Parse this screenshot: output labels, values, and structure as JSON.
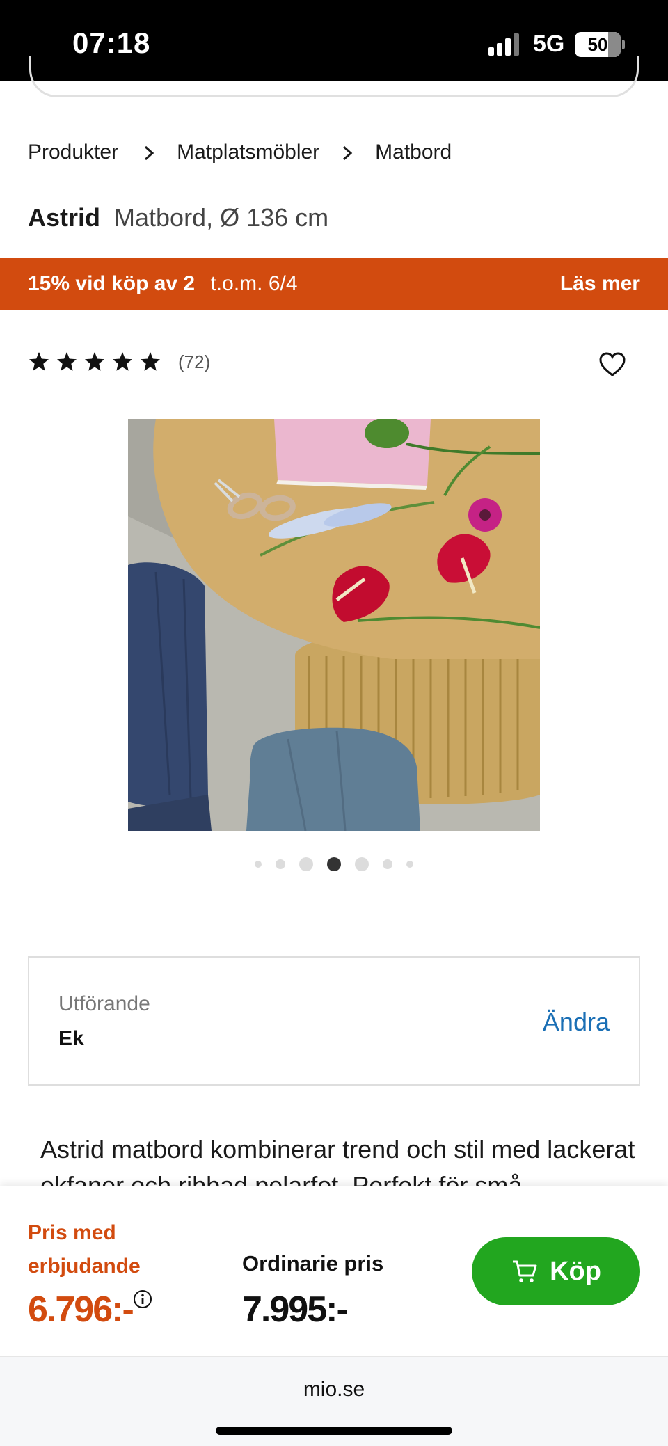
{
  "status_bar": {
    "time": "07:18",
    "network": "5G",
    "battery": "50"
  },
  "breadcrumb": [
    "Produkter",
    "Matplatsmöbler",
    "Matbord"
  ],
  "product": {
    "name": "Astrid",
    "description": "Matbord, Ø 136 cm"
  },
  "promo": {
    "offer": "15% vid köp av 2",
    "until": "t.o.m. 6/4",
    "link": "Läs mer",
    "color": "#d24b0f"
  },
  "rating": {
    "stars": 5,
    "count": "(72)"
  },
  "gallery": {
    "image_count": 7,
    "active_index": 3
  },
  "variant": {
    "label": "Utförande",
    "value": "Ek",
    "change_label": "Ändra"
  },
  "description_text": "Astrid matbord kombinerar trend och stil med lackerat ekfaner och ribbad pelarfot. Perfekt för små",
  "price": {
    "offer_label": "Pris med erbjudande",
    "offer_price": "6.796:-",
    "ordinary_label": "Ordinarie pris",
    "ordinary_price": "7.995:-",
    "buy_label": "Köp",
    "buy_color": "#22a61f"
  },
  "browser": {
    "url": "mio.se"
  }
}
